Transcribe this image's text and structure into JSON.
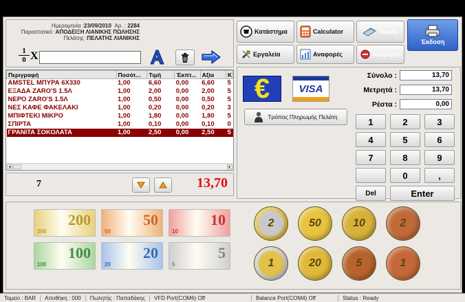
{
  "header": {
    "date_label": "Ημερομηνία :",
    "date_value": "23/09/2010",
    "doc_no_label": "Αρ. :",
    "doc_no_value": "2284",
    "doc_type_label": "Παραστατικό :",
    "doc_type_value": "ΑΠΟΔΕΙΞΗ ΛΙΑΝΙΚΗΣ ΠΩΛΗΣΗΣ",
    "customer_label": "Πελάτης :",
    "customer_value": "ΠΕΛΑΤΗΣ ΛΙΑΝΙΚΗΣ"
  },
  "entry": {
    "qty_prefix": "1",
    "qty_suffix": "0",
    "times_symbol": "X",
    "input_value": ""
  },
  "menu": {
    "store": "Κατάστημα",
    "calculator": "Calculator",
    "cashbox": "Ταμείο",
    "issue": "Έκδοση",
    "tools": "Εργαλεία",
    "reports": "Αναφορές",
    "cancel": "Ακύρωση"
  },
  "table": {
    "columns": [
      "Περιγραφή",
      "Ποσότ...",
      "Τιμή",
      "Έκπτ...",
      "Αξία",
      "Κ"
    ],
    "rows": [
      [
        "AMSTEL ΜΠΥΡΑ 6Χ330",
        "1,00",
        "6,60",
        "0,00",
        "6,60",
        "5"
      ],
      [
        "ΕΞΑΔΑ ZARO'S 1.5Λ",
        "1,00",
        "2,00",
        "0,00",
        "2,00",
        "5"
      ],
      [
        "ΝΕΡΟ ZARO'S 1.5Λ",
        "1,00",
        "0,50",
        "0,00",
        "0,50",
        "5"
      ],
      [
        "ΝΕΣ ΚΑΦΕ ΦΑΚΕΛΑΚΙ",
        "1,00",
        "0,20",
        "0,00",
        "0,20",
        "3"
      ],
      [
        "ΜΠΙΦΤΕΚΙ ΜΙΚΡΟ",
        "1,00",
        "1,80",
        "0,00",
        "1,80",
        "5"
      ],
      [
        "ΣΠΙΡΤΑ",
        "1,00",
        "0,10",
        "0,00",
        "0,10",
        "0"
      ],
      [
        "ΓΡΑΝΙΤΑ ΣΟΚΟΛΑΤΑ",
        "1,00",
        "2,50",
        "0,00",
        "2,50",
        "5"
      ]
    ],
    "selected_row": 6
  },
  "footer": {
    "item_count": "7",
    "total": "13,70"
  },
  "payment": {
    "euro_symbol": "€",
    "visa_label": "VISA",
    "customer_payment_button": "Τρόπος Πληρωμής Πελάτη",
    "total_label": "Σύνολο :",
    "total_value": "13,70",
    "cash_label": "Μετρητά :",
    "cash_value": "13,70",
    "change_label": "Ρέστα :",
    "change_value": "0,00"
  },
  "keypad": {
    "keys": [
      "1",
      "2",
      "3",
      "4",
      "5",
      "6",
      "7",
      "8",
      "9",
      "",
      "0",
      ","
    ],
    "del": "Del",
    "enter": "Enter"
  },
  "notes": [
    {
      "value": "200",
      "color": "#e8d27a",
      "accent": "#b89a30"
    },
    {
      "value": "50",
      "color": "#f0b27a",
      "accent": "#c86a2a"
    },
    {
      "value": "10",
      "color": "#f2a0a0",
      "accent": "#c03838"
    },
    {
      "value": "100",
      "color": "#a8d8a0",
      "accent": "#4a8a4a"
    },
    {
      "value": "20",
      "color": "#a8c4ec",
      "accent": "#3a68b0"
    },
    {
      "value": "5",
      "color": "#cfcfcf",
      "accent": "#808080"
    }
  ],
  "coins": [
    {
      "value": "2",
      "rim": "#e2c24a",
      "center": "#c9c9c9"
    },
    {
      "value": "50",
      "rim": "#e8c340",
      "center": "#e8c340"
    },
    {
      "value": "10",
      "rim": "#d8b238",
      "center": "#d8b238"
    },
    {
      "value": "2",
      "rim": "#c06a3a",
      "center": "#c06a3a"
    },
    {
      "value": "1",
      "rim": "#cfcfcf",
      "center": "#e2c24a"
    },
    {
      "value": "20",
      "rim": "#e0b83a",
      "center": "#e0b83a"
    },
    {
      "value": "5",
      "rim": "#b8622e",
      "center": "#b8622e"
    },
    {
      "value": "1",
      "rim": "#c4683a",
      "center": "#c4683a"
    }
  ],
  "status": {
    "cashbox": "Ταμείο : BAR",
    "warehouse": "Αποθήκη : 000",
    "seller": "Πωλητής : Παπαδάκης",
    "vfd": "VFD Port(COM6) Off",
    "balance": "Balance Port(COM4) Off",
    "state": "Status : Ready"
  }
}
